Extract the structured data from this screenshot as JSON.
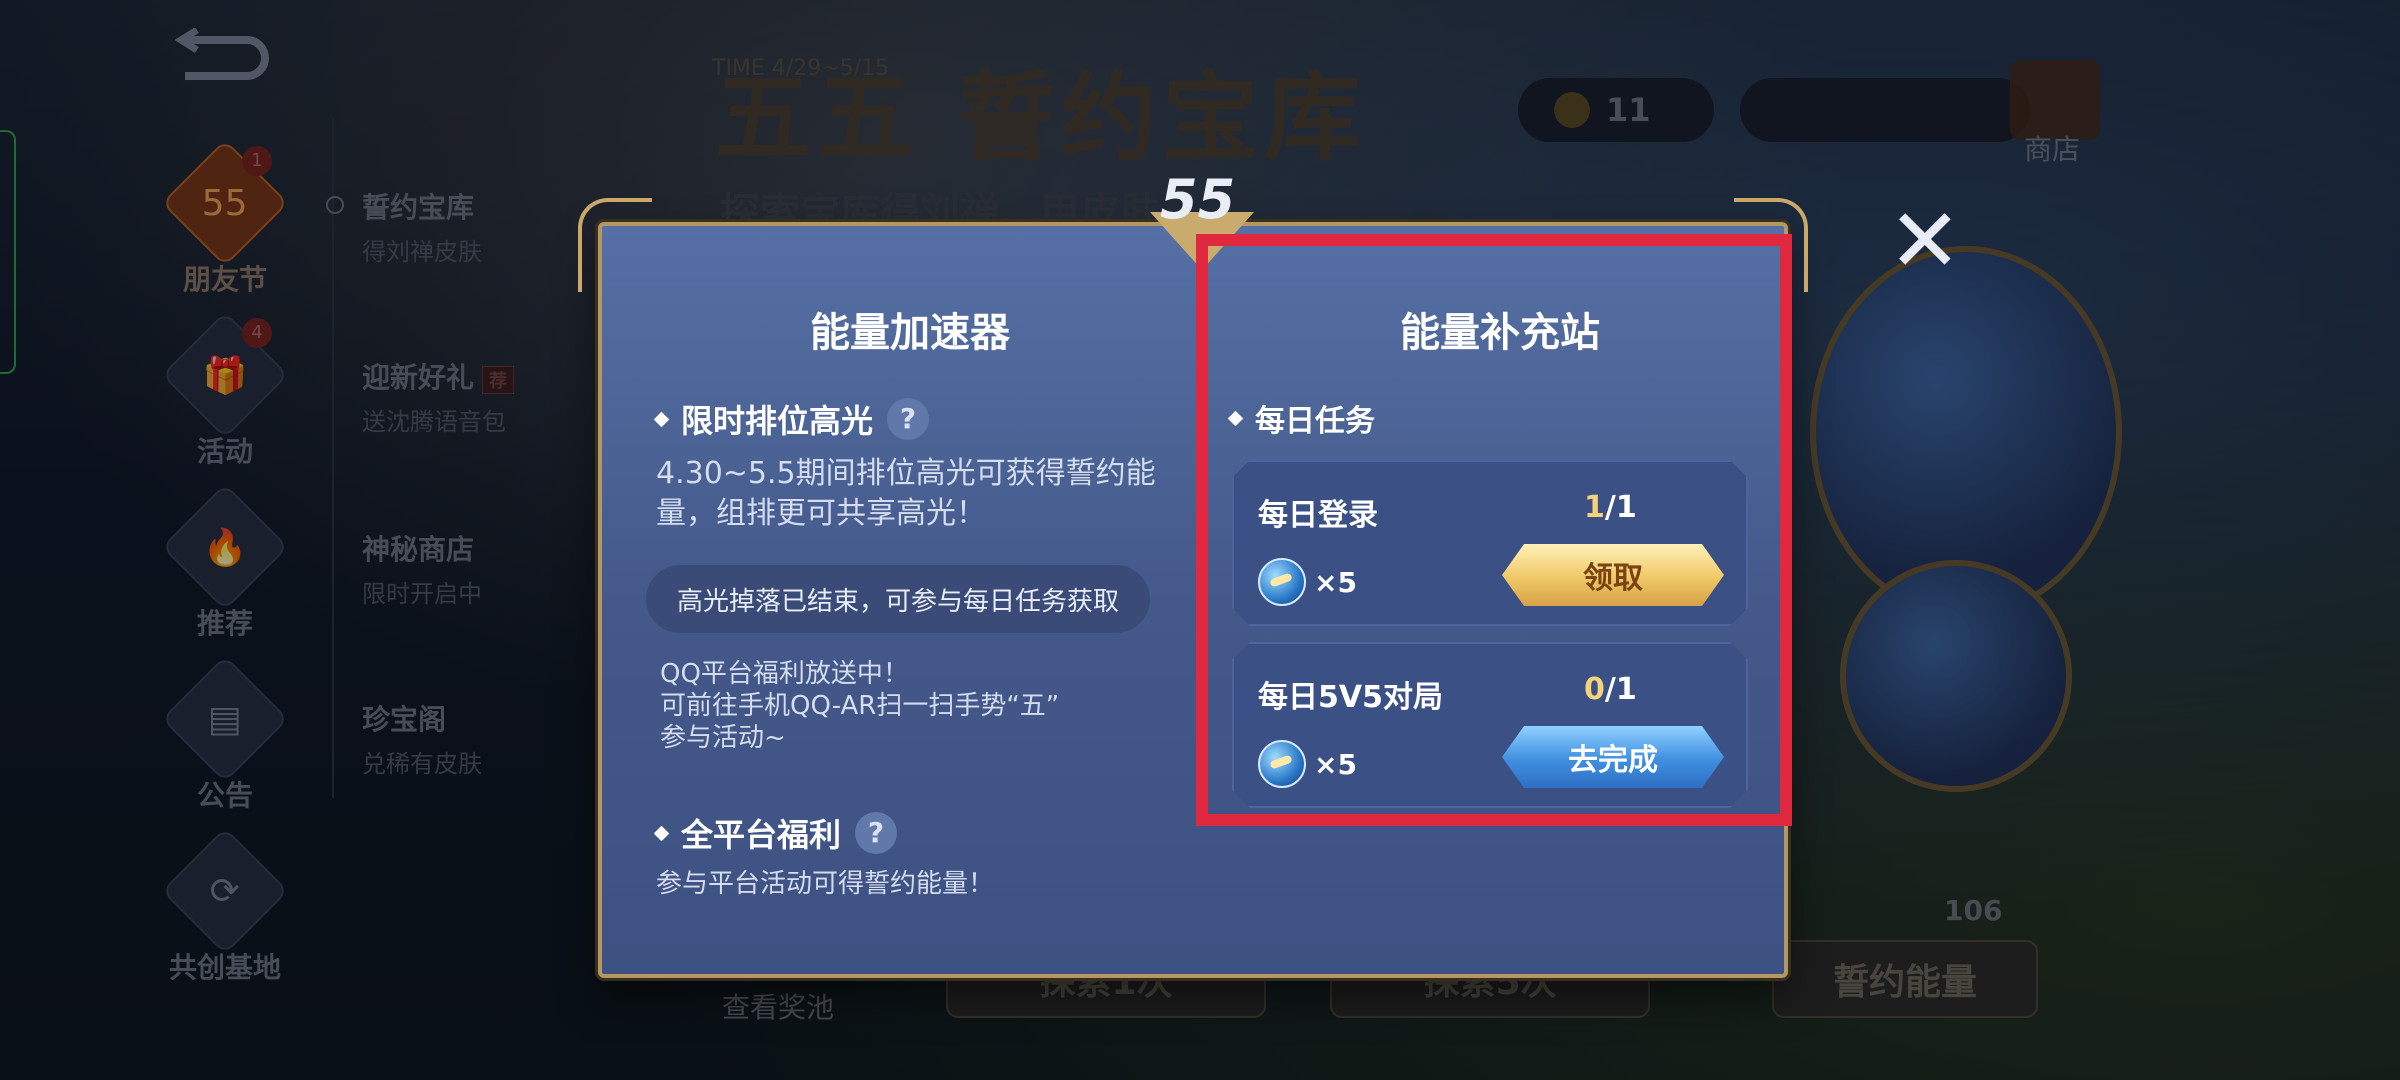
{
  "background": {
    "time_label": "TIME 4/29~5/15",
    "event_title": "五五 誓约宝库",
    "event_subtitle": "探索宝库得刘禅…甲皮肤",
    "coin_count": "11",
    "shop_label": "商店",
    "view_pool_label": "查看奖池",
    "explore_1": "探索1次",
    "explore_5": "探索5次",
    "energy_count": "106",
    "energy_button": "誓约能量"
  },
  "sidebar": {
    "items": [
      {
        "label": "朋友节",
        "icon": "friend-festival-icon",
        "glyph": "55",
        "badge": "1"
      },
      {
        "label": "活动",
        "icon": "gift-icon",
        "glyph": "🎁",
        "badge": "4"
      },
      {
        "label": "推荐",
        "icon": "flame-icon",
        "glyph": "🔥",
        "badge": ""
      },
      {
        "label": "公告",
        "icon": "calendar-icon",
        "glyph": "▤",
        "badge": ""
      },
      {
        "label": "共创基地",
        "icon": "cocreate-icon",
        "glyph": "⟳",
        "badge": ""
      }
    ]
  },
  "subnav": {
    "items": [
      {
        "title": "誓约宝库",
        "sub": "得刘禅皮肤",
        "tag": ""
      },
      {
        "title": "迎新好礼",
        "sub": "送沈腾语音包",
        "tag": "荐"
      },
      {
        "title": "神秘商店",
        "sub": "限时开启中",
        "tag": ""
      },
      {
        "title": "珍宝阁",
        "sub": "兑稀有皮肤",
        "tag": ""
      }
    ]
  },
  "modal": {
    "logo": "55",
    "left": {
      "title": "能量加速器",
      "section1_title": "限时排位高光",
      "section1_text": "4.30~5.5期间排位高光可获得誓约能量，组排更可共享高光！",
      "ended_notice": "高光掉落已结束，可参与每日任务获取",
      "qq_line1": "QQ平台福利放送中！",
      "qq_line2": "可前往手机QQ-AR扫一扫手势“五”",
      "qq_line3": "参与活动~",
      "section2_title": "全平台福利",
      "section2_text": "参与平台活动可得誓约能量！"
    },
    "right": {
      "title": "能量补充站",
      "section_title": "每日任务",
      "tasks": [
        {
          "name": "每日登录",
          "current": "1",
          "total": "/1",
          "reward_mult": "×5",
          "button": "领取"
        },
        {
          "name": "每日5V5对局",
          "current": "0",
          "total": "/1",
          "reward_mult": "×5",
          "button": "去完成"
        }
      ]
    },
    "help_glyph": "?",
    "close_glyph": "✕"
  },
  "colors": {
    "highlight": "#e0283f",
    "claim_button": "#f0c866",
    "go_button": "#3f8fe0",
    "progress_current": "#f4d37c"
  }
}
